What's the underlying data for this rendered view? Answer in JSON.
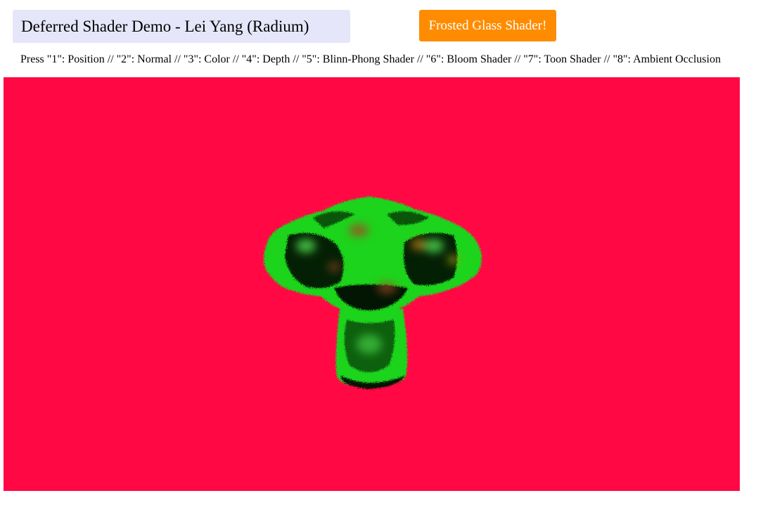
{
  "header": {
    "title": "Deferred Shader Demo - Lei Yang (Radium)",
    "shader_button_label": "Frosted Glass Shader!",
    "instructions": "Press \"1\": Position // \"2\": Normal // \"3\": Color // \"4\": Depth // \"5\": Blinn-Phong Shader // \"6\": Bloom Shader // \"7\": Toon Shader // \"8\": Ambient Occlusion"
  },
  "viewport": {
    "background_color": "#ff0844",
    "model": "monkey-head-model",
    "model_primary_color": "#1fd41f",
    "model_shadow_color": "#000000",
    "model_highlight_color": "#a04a24"
  },
  "colors": {
    "title_bg": "#e6e6fa",
    "button_bg": "#ff8c00",
    "button_text": "#ffffff"
  }
}
